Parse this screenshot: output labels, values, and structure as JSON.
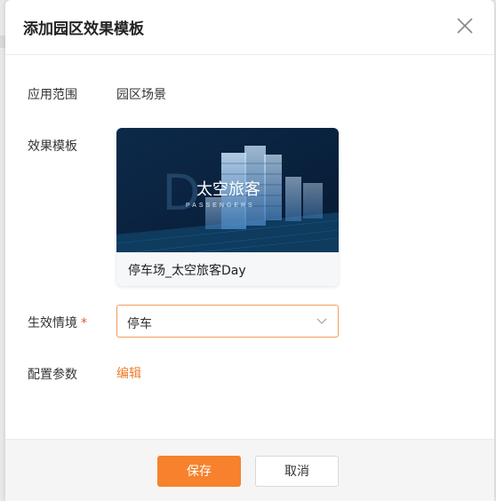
{
  "dialog": {
    "title": "添加园区效果模板",
    "fields": {
      "scope_label": "应用范围",
      "scope_value": "园区场景",
      "template_label": "效果模板",
      "template_card": {
        "image_text_main": "太空旅客",
        "image_text_sub": "PASSENGERS",
        "caption": "停车场_太空旅客Day"
      },
      "context_label": "生效情境",
      "context_required_mark": "*",
      "context_value": "停车",
      "params_label": "配置参数",
      "params_link": "编辑"
    },
    "footer": {
      "save_label": "保存",
      "cancel_label": "取消"
    }
  },
  "colors": {
    "accent": "#f7812c",
    "link": "#ee7b2a",
    "required": "#e8533c"
  }
}
